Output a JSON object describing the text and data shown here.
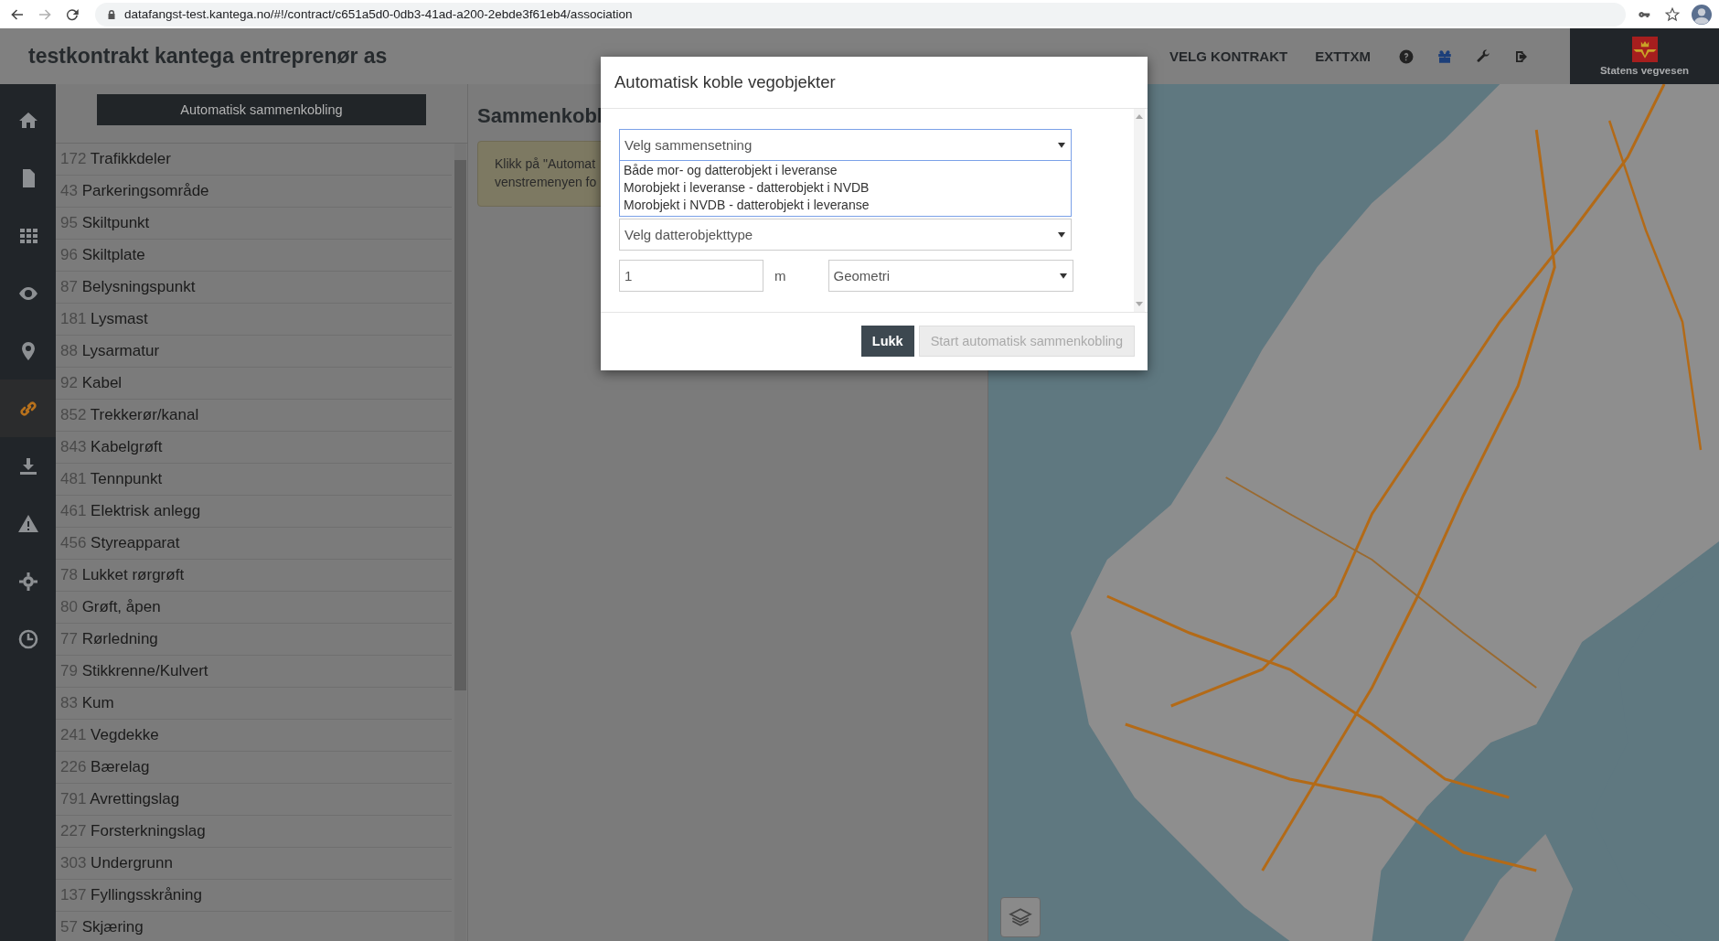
{
  "browser": {
    "url": "datafangst-test.kantega.no/#!/contract/c651a5d0-0db3-41ad-a200-2ebde3f61eb4/association"
  },
  "header": {
    "title": "testkontrakt kantega entreprenør as",
    "nav": [
      "VELG KONTRAKT",
      "EXTTXM"
    ],
    "logo_caption": "Statens vegvesen"
  },
  "sidebar": {
    "items": [
      {
        "selected": false
      },
      {
        "selected": false
      },
      {
        "selected": false
      },
      {
        "selected": false
      },
      {
        "selected": false
      },
      {
        "selected": true
      },
      {
        "selected": false
      },
      {
        "selected": false
      },
      {
        "selected": false
      },
      {
        "selected": false
      }
    ]
  },
  "list_panel": {
    "button": "Automatisk sammenkobling",
    "items": [
      {
        "number": "172",
        "name": "Trafikkdeler"
      },
      {
        "number": "43",
        "name": "Parkeringsområde"
      },
      {
        "number": "95",
        "name": "Skiltpunkt"
      },
      {
        "number": "96",
        "name": "Skiltplate"
      },
      {
        "number": "87",
        "name": "Belysningspunkt"
      },
      {
        "number": "181",
        "name": "Lysmast"
      },
      {
        "number": "88",
        "name": "Lysarmatur"
      },
      {
        "number": "92",
        "name": "Kabel"
      },
      {
        "number": "852",
        "name": "Trekkerør/kanal"
      },
      {
        "number": "843",
        "name": "Kabelgrøft"
      },
      {
        "number": "481",
        "name": "Tennpunkt"
      },
      {
        "number": "461",
        "name": "Elektrisk anlegg"
      },
      {
        "number": "456",
        "name": "Styreapparat"
      },
      {
        "number": "78",
        "name": "Lukket rørgrøft"
      },
      {
        "number": "80",
        "name": "Grøft, åpen"
      },
      {
        "number": "77",
        "name": "Rørledning"
      },
      {
        "number": "79",
        "name": "Stikkrenne/Kulvert"
      },
      {
        "number": "83",
        "name": "Kum"
      },
      {
        "number": "241",
        "name": "Vegdekke"
      },
      {
        "number": "226",
        "name": "Bærelag"
      },
      {
        "number": "791",
        "name": "Avrettingslag"
      },
      {
        "number": "227",
        "name": "Forsterkningslag"
      },
      {
        "number": "303",
        "name": "Undergrunn"
      },
      {
        "number": "137",
        "name": "Fyllingsskråning"
      },
      {
        "number": "57",
        "name": "Skjæring"
      }
    ]
  },
  "main": {
    "heading": "Sammenkobl",
    "notice_lines": [
      "Klikk på \"Automat",
      "venstremenyen fo"
    ]
  },
  "dialog": {
    "title": "Automatisk koble vegobjekter",
    "composition_select": {
      "value": "Velg sammensetning",
      "expanded": true,
      "options": [
        "Både mor- og datterobjekt i leveranse",
        "Morobjekt i leveranse - datterobjekt i NVDB",
        "Morobjekt i NVDB - datterobjekt i leveranse"
      ]
    },
    "child_type_select": {
      "value": "Velg datterobjekttype"
    },
    "distance": {
      "value": "1",
      "unit": "m"
    },
    "method_select": {
      "value": "Geometri"
    },
    "buttons": [
      {
        "label": "Lukk",
        "disabled": false
      },
      {
        "label": "Start automatisk sammenkobling",
        "disabled": true
      }
    ]
  }
}
